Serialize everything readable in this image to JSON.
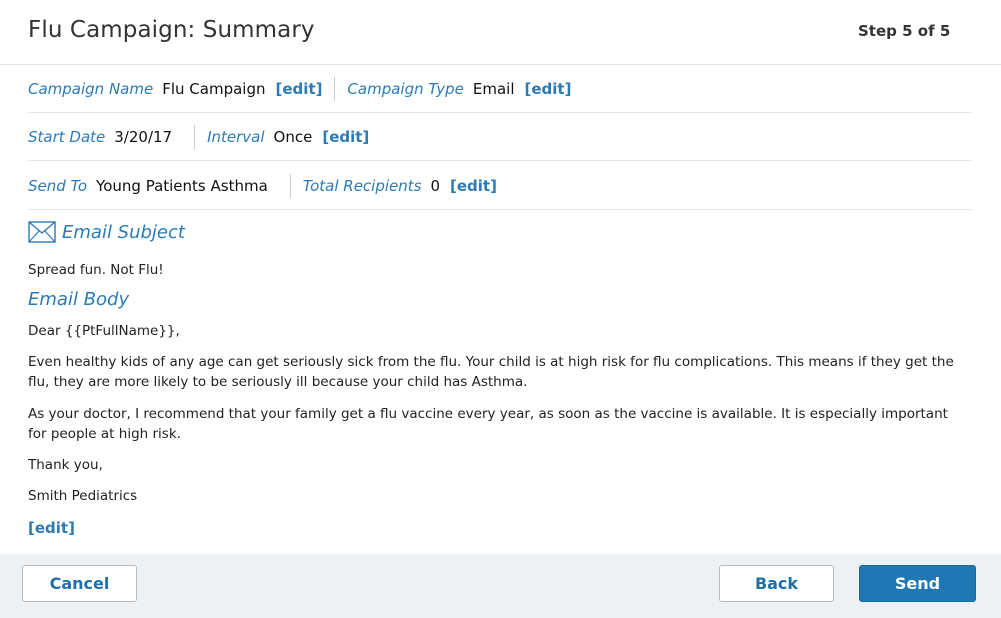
{
  "header": {
    "title": "Flu Campaign: Summary",
    "step": "Step 5 of 5"
  },
  "summary": {
    "campaign_name_label": "Campaign Name",
    "campaign_name_value": "Flu Campaign",
    "campaign_type_label": "Campaign Type",
    "campaign_type_value": "Email",
    "start_date_label": "Start Date",
    "start_date_value": "3/20/17",
    "interval_label": "Interval",
    "interval_value": "Once",
    "send_to_label": "Send To",
    "send_to_value": "Young Patients Asthma",
    "total_recipients_label": "Total Recipients",
    "total_recipients_value": "0",
    "edit_label": "[edit]"
  },
  "email": {
    "subject_heading": "Email Subject",
    "subject_icon": "envelope-icon",
    "subject_text": "Spread fun. Not Flu!",
    "body_heading": "Email Body",
    "greeting": "Dear {{PtFullName}},",
    "paragraph1": "Even healthy kids of any age can get seriously sick from the flu. Your child is at high risk for flu complications. This means if they get the flu, they are more likely to be seriously ill because your child has Asthma.",
    "paragraph2": "As your doctor, I recommend that your family get a flu vaccine every year, as soon as the vaccine is available. It is especially important for people at high risk.",
    "closing": "Thank you,",
    "signature": "Smith Pediatrics",
    "edit_label": "[edit]"
  },
  "footer": {
    "cancel_label": "Cancel",
    "back_label": "Back",
    "send_label": "Send"
  },
  "colors": {
    "accent": "#2c7bb6",
    "primary_button": "#1f78b4",
    "footer_bg": "#eef1f4"
  }
}
